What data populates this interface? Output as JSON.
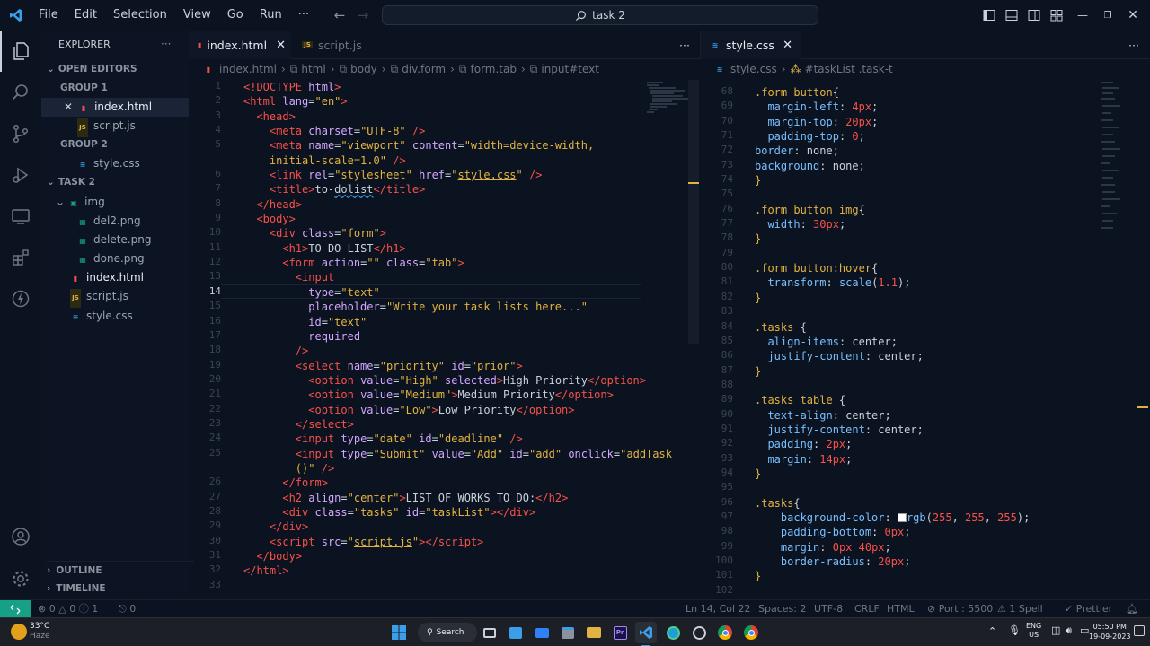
{
  "menu": [
    "File",
    "Edit",
    "Selection",
    "View",
    "Go",
    "Run",
    "···"
  ],
  "search": {
    "label": "task 2"
  },
  "explorer": {
    "title": "EXPLORER",
    "open_editors": "OPEN EDITORS",
    "group1": "GROUP 1",
    "group1_files": [
      "index.html",
      "script.js"
    ],
    "group2": "GROUP 2",
    "group2_files": [
      "style.css"
    ],
    "folder": "TASK 2",
    "subfolder": "img",
    "img_files": [
      "del2.png",
      "delete.png",
      "done.png"
    ],
    "root_files": [
      "index.html",
      "script.js",
      "style.css"
    ],
    "outline": "OUTLINE",
    "timeline": "TIMELINE"
  },
  "editor1": {
    "tabs": [
      {
        "label": "index.html",
        "active": true
      },
      {
        "label": "script.js",
        "active": false
      }
    ],
    "breadcrumb": [
      "index.html",
      "html",
      "body",
      "div.form",
      "form.tab",
      "input#text"
    ],
    "line_numbers": [
      "1",
      "2",
      "3",
      "4",
      "5",
      "",
      "6",
      "7",
      "8",
      "9",
      "10",
      "11",
      "12",
      "13",
      "14",
      "15",
      "16",
      "17",
      "18",
      "19",
      "20",
      "21",
      "22",
      "23",
      "24",
      "25",
      "",
      "26",
      "27",
      "28",
      "29",
      "30",
      "31",
      "32",
      "33"
    ]
  },
  "editor2": {
    "tabs": [
      {
        "label": "style.css",
        "active": true
      }
    ],
    "breadcrumb": [
      "style.css",
      "#taskList .task-t"
    ],
    "line_numbers": [
      "68",
      "69",
      "70",
      "71",
      "72",
      "73",
      "74",
      "75",
      "76",
      "77",
      "78",
      "79",
      "80",
      "81",
      "82",
      "83",
      "84",
      "85",
      "86",
      "87",
      "88",
      "89",
      "90",
      "91",
      "92",
      "93",
      "94",
      "95",
      "96",
      "97",
      "98",
      "99",
      "100",
      "101",
      "102"
    ]
  },
  "status": {
    "errors": "0",
    "warnings": "0",
    "info": "1",
    "ports": "0",
    "position": "Ln 14, Col 22",
    "spaces": "Spaces: 2",
    "encoding": "UTF-8",
    "eol": "CRLF",
    "language": "HTML",
    "port": "Port : 5500",
    "spell": "1 Spell",
    "prettier": "Prettier"
  },
  "taskbar": {
    "weather_temp": "33°C",
    "weather_desc": "Haze",
    "search": "Search",
    "lang1": "ENG",
    "lang2": "US",
    "time": "05:50 PM",
    "date": "19-09-2023"
  },
  "colors": {
    "accent": "#16a085",
    "tag": "#f85149",
    "attr": "#d2a8ff",
    "string": "#e3b341",
    "selector": "#e3b341",
    "prop": "#79c0ff",
    "num": "#f85149"
  }
}
